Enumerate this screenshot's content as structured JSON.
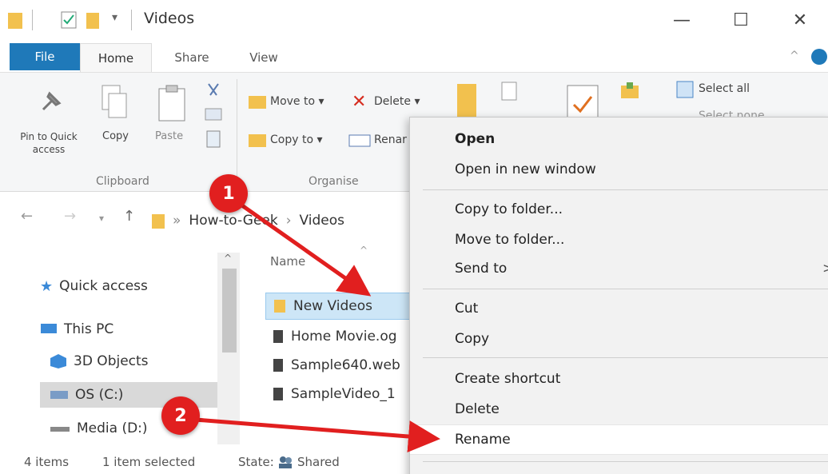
{
  "window": {
    "title": "Videos",
    "minimize_glyph": "—",
    "maximize_glyph": "☐",
    "close_glyph": "✕"
  },
  "tabs": [
    "File",
    "Home",
    "Share",
    "View"
  ],
  "ribbon": {
    "pin_label": "Pin to Quick access",
    "copy_label": "Copy",
    "paste_label": "Paste",
    "clipboard_group": "Clipboard",
    "move_to": "Move to",
    "delete": "Delete",
    "copy_to": "Copy to",
    "rename_partial": "Renar",
    "organise_group": "Organise",
    "select_all": "Select all",
    "select_none_partial": "Select none"
  },
  "address": {
    "crumbs": [
      "How-to-Geek",
      "Videos"
    ]
  },
  "nav_pane": {
    "items": [
      "Quick access",
      "This PC",
      "3D Objects",
      "OS (C:)",
      "Media (D:)"
    ]
  },
  "file_list": {
    "column_name": "Name",
    "rows": [
      "New Videos",
      "Home Movie.og",
      "Sample640.web",
      "SampleVideo_1"
    ]
  },
  "status": {
    "count": "4 items",
    "selected": "1 item selected",
    "state": "State:",
    "shared": "Shared"
  },
  "context_menu": {
    "items": [
      "Open",
      "Open in new window",
      "Copy to folder...",
      "Move to folder...",
      "Send to",
      "Cut",
      "Copy",
      "Create shortcut",
      "Delete",
      "Rename"
    ],
    "send_to_arrow": ">"
  },
  "annotations": {
    "step1": "1",
    "step2": "2",
    "arrow_color": "#e11f1f"
  },
  "colors": {
    "file_tab": "#1f79b9",
    "selection": "#cde6f7",
    "folder": "#f2c14e"
  }
}
